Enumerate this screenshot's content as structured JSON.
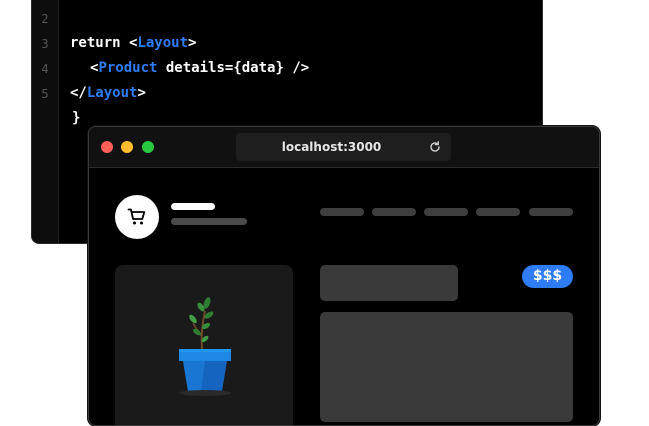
{
  "editor": {
    "lines": [
      {
        "num": "2",
        "kw": "return",
        "open": "<",
        "tag": "Layout",
        "close": ">",
        "attr": ""
      },
      {
        "num": "3",
        "kw": "",
        "open": "<",
        "tag": "Product",
        "close": " />",
        "attr": " details={data}"
      },
      {
        "num": "4",
        "kw": "",
        "open": "</",
        "tag": "Layout",
        "close": ">",
        "attr": ""
      },
      {
        "num": "5",
        "kw": "}",
        "open": "",
        "tag": "",
        "close": "",
        "attr": ""
      }
    ]
  },
  "browser": {
    "url": "localhost:3000",
    "product": {
      "price_badge": "$$$"
    }
  },
  "colors": {
    "accent": "#2f7df6",
    "close_dot": "#fe5f57",
    "minimize_dot": "#febc2e",
    "maximize_dot": "#28c840",
    "placeholder": "#3a3a3a"
  },
  "icons": {
    "logo": "shopping-cart-icon",
    "reload": "reload-icon",
    "product_image": "potted-plant-icon"
  }
}
